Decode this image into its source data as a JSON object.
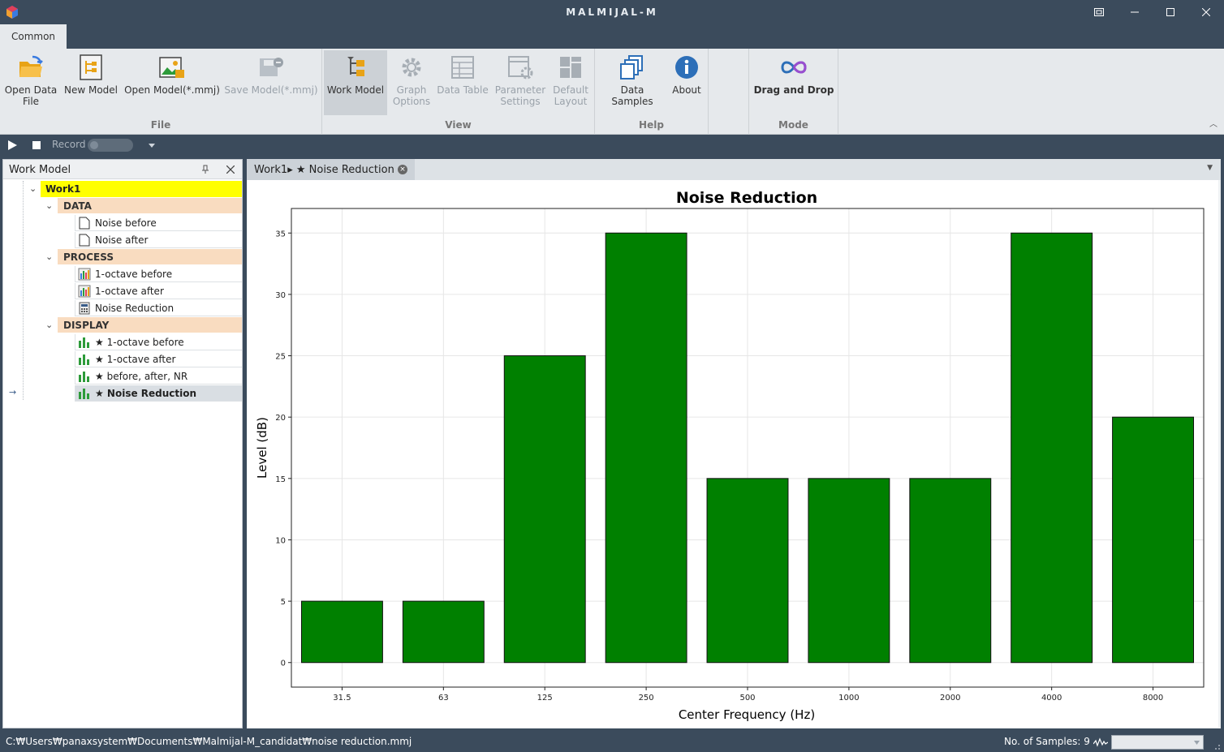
{
  "window": {
    "title": "MALMIJAL-M",
    "controls": [
      "restore-layout",
      "minimize",
      "maximize",
      "close"
    ]
  },
  "ribbon": {
    "tab": "Common",
    "groups": {
      "file": {
        "label": "File",
        "open_data_file_line1": "Open Data",
        "open_data_file_line2": "File",
        "new_model": "New Model",
        "open_model": "Open Model(*.mmj)",
        "save_model": "Save Model(*.mmj)"
      },
      "view": {
        "label": "View",
        "work_model": "Work Model",
        "graph_options_line1": "Graph",
        "graph_options_line2": "Options",
        "data_table": "Data Table",
        "parameter_settings_line1": "Parameter",
        "parameter_settings_line2": "Settings",
        "default_layout_line1": "Default",
        "default_layout_line2": "Layout"
      },
      "help": {
        "label": "Help",
        "data_samples": "Data Samples",
        "about": "About"
      },
      "mode": {
        "label": "Mode",
        "drag_and_drop": "Drag and Drop"
      }
    }
  },
  "macrobar": {
    "record_label": "Record"
  },
  "work_model_panel": {
    "title": "Work Model",
    "root": "Work1",
    "categories": [
      {
        "label": "DATA",
        "items": [
          "Noise before",
          "Noise after"
        ]
      },
      {
        "label": "PROCESS",
        "items": [
          "1-octave before",
          "1-octave after",
          "Noise Reduction"
        ]
      },
      {
        "label": "DISPLAY",
        "items": [
          "★ 1-octave before",
          "★ 1-octave after",
          "★ before, after, NR",
          "★ Noise Reduction"
        ]
      }
    ],
    "selected_item": "★ Noise Reduction"
  },
  "document": {
    "tab_label": "Work1▸ ★ Noise Reduction"
  },
  "chart_data": {
    "type": "bar",
    "title": "Noise Reduction",
    "xlabel": "Center Frequency (Hz)",
    "ylabel": "Level (dB)",
    "categories": [
      "31.5",
      "63",
      "125",
      "250",
      "500",
      "1000",
      "2000",
      "4000",
      "8000"
    ],
    "values": [
      5,
      5,
      25,
      35,
      15,
      15,
      15,
      35,
      20
    ],
    "ylim": [
      -2,
      37
    ],
    "yticks": [
      0,
      5,
      10,
      15,
      20,
      25,
      30,
      35
    ],
    "bar_color": "#008000",
    "grid": true,
    "legend": "none"
  },
  "statusbar": {
    "path": "C:₩Users₩panaxsystem₩Documents₩Malmijal-M_candidat₩noise reduction.mmj",
    "samples": "No. of Samples: 9"
  },
  "colors": {
    "chrome": "#3b4b5c",
    "ribbon": "#e6e9ec",
    "root_highlight": "#ffff00",
    "category_bg": "#f9dcc0"
  }
}
